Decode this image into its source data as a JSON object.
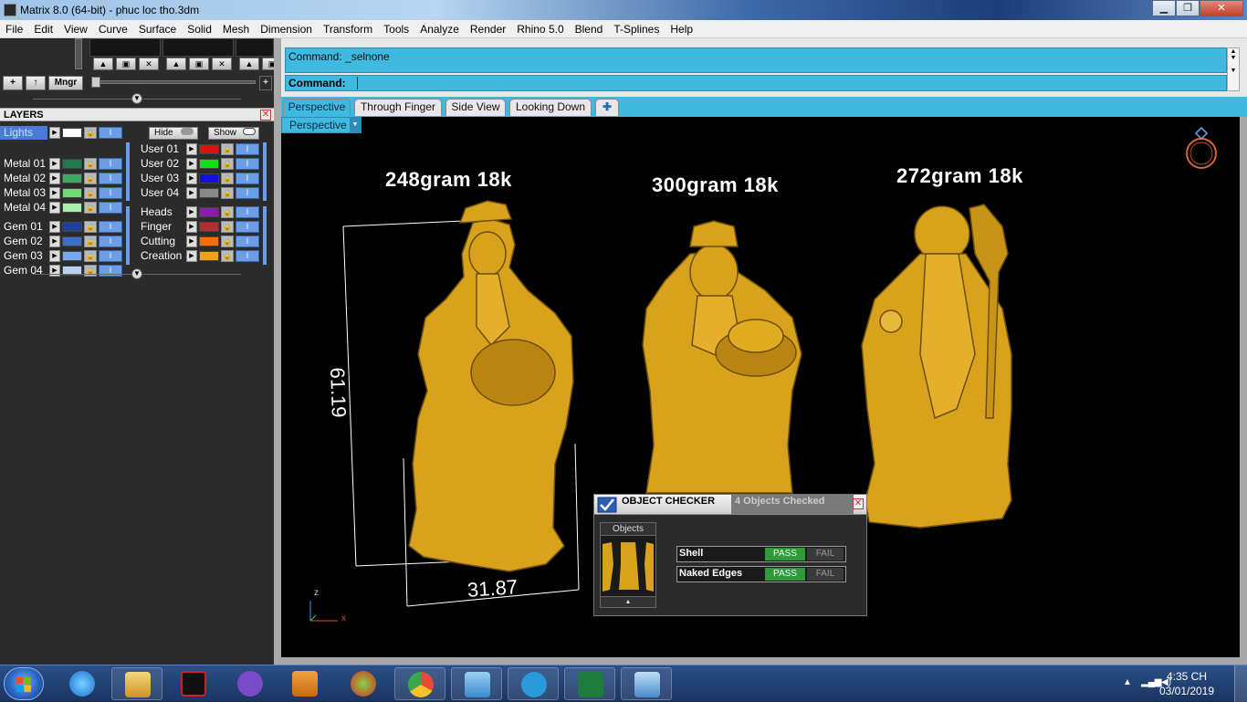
{
  "window": {
    "title": "Matrix 8.0 (64-bit) - phuc loc tho.3dm",
    "minimize": "▁",
    "restore": "❐",
    "close": "✕"
  },
  "menu": [
    "File",
    "Edit",
    "View",
    "Curve",
    "Surface",
    "Solid",
    "Mesh",
    "Dimension",
    "Transform",
    "Tools",
    "Analyze",
    "Render",
    "Rhino 5.0",
    "Blend",
    "T-Splines",
    "Help"
  ],
  "manager": {
    "add": "+",
    "up": "↑",
    "mngr": "Mngr",
    "plus_right": "+"
  },
  "layers": {
    "title": "LAYERS",
    "close": "✕",
    "hide_label": "Hide",
    "show_label": "Show",
    "left": [
      {
        "name": "Lights",
        "color": "#ffffff",
        "selected": true
      },
      {
        "name": "Metal 01",
        "color": "#1e7a4a"
      },
      {
        "name": "Metal 02",
        "color": "#3ea860"
      },
      {
        "name": "Metal 03",
        "color": "#6fd86f"
      },
      {
        "name": "Metal 04",
        "color": "#a8f0a8"
      },
      {
        "name": "Gem 01",
        "color": "#1c3fa0"
      },
      {
        "name": "Gem 02",
        "color": "#3a6fd0"
      },
      {
        "name": "Gem 03",
        "color": "#7aa8f0"
      },
      {
        "name": "Gem 04",
        "color": "#b8d0f8"
      }
    ],
    "right": [
      {
        "name": "User 01",
        "color": "#e01010"
      },
      {
        "name": "User 02",
        "color": "#10e010"
      },
      {
        "name": "User 03",
        "color": "#1010e0"
      },
      {
        "name": "User 04",
        "color": "#888888"
      },
      {
        "name": "Heads",
        "color": "#8a1ea8"
      },
      {
        "name": "Finger",
        "color": "#b03030"
      },
      {
        "name": "Cutting",
        "color": "#f07010"
      },
      {
        "name": "Creation",
        "color": "#f0a020"
      }
    ]
  },
  "command": {
    "history": "Command: _selnone",
    "label": "Command:",
    "value": ""
  },
  "tabs": [
    "Perspective",
    "Through Finger",
    "Side View",
    "Looking Down",
    "✚"
  ],
  "viewport": {
    "label": "Perspective",
    "weights": [
      "248gram 18k",
      "300gram 18k",
      "272gram 18k"
    ],
    "dim_height": "61.19",
    "dim_width": "31.87",
    "axis_z": "z",
    "axis_x": "x",
    "gold": "#d8a21c"
  },
  "checker": {
    "title": "OBJECT CHECKER",
    "status": "4 Objects Checked",
    "objects_label": "Objects",
    "rows": [
      {
        "name": "Shell",
        "pass": "PASS",
        "fail": "FAIL"
      },
      {
        "name": "Naked Edges",
        "pass": "PASS",
        "fail": "FAIL"
      }
    ]
  },
  "taskbar": {
    "time": "4:35 CH",
    "date": "03/01/2019",
    "apps": [
      "internet-explorer",
      "file-explorer",
      "garena",
      "viber",
      "media-player",
      "paint-app",
      "chrome",
      "control-panel",
      "vpn-client",
      "excel",
      "photo-viewer"
    ]
  }
}
